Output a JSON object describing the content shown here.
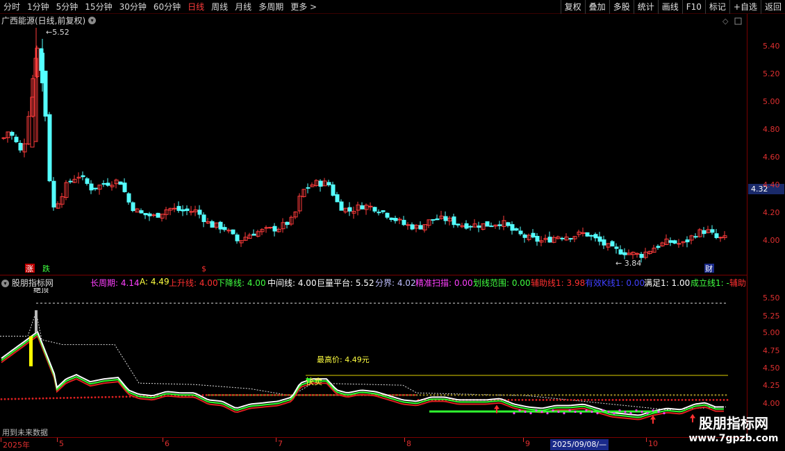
{
  "toolbar": {
    "periods": [
      "分时",
      "1分钟",
      "5分钟",
      "15分钟",
      "30分钟",
      "60分钟",
      "日线",
      "周线",
      "月线",
      "多周期",
      "更多 >"
    ],
    "active_period": "日线",
    "tools": [
      "复权",
      "叠加",
      "多股",
      "统计",
      "画线",
      "F10",
      "标记",
      "+自选",
      "返回"
    ]
  },
  "stock": {
    "title": "广西能源(日线,前复权)",
    "high_mark": "5.52",
    "low_mark": "3.84",
    "current_price": "4.32"
  },
  "price_axis": [
    "5.40",
    "5.20",
    "5.00",
    "4.80",
    "4.60",
    "4.40",
    "4.20",
    "4.00"
  ],
  "markers": {
    "rise": "涨",
    "fall": "跌",
    "dollar": "$",
    "finance": "财"
  },
  "indicator": {
    "name": "股朋指标网",
    "fields": [
      {
        "text": "长周期: 4.14",
        "color": "#ff40ff"
      },
      {
        "text": "A: 4.49",
        "color": "#ffff40"
      },
      {
        "text": "上升线: 4.00",
        "color": "#ff3030"
      },
      {
        "text": "下降线: 4.00",
        "color": "#40ff40"
      },
      {
        "text": "中间线: 4.00",
        "color": "#ffffff"
      },
      {
        "text": "巨量平台: 5.52",
        "color": "#ffffff"
      },
      {
        "text": "分界: 4.02",
        "color": "#c0c0ff"
      },
      {
        "text": "精准扫描: 0.00",
        "color": "#ff40ff"
      },
      {
        "text": "划线范围: 0.00",
        "color": "#40ff40"
      },
      {
        "text": "辅助线1: 3.98",
        "color": "#ff3030"
      },
      {
        "text": "有效K线1: 0.00",
        "color": "#4040ff"
      },
      {
        "text": "满足1: 1.00",
        "color": "#ffffff"
      },
      {
        "text": "成立线1: -",
        "color": "#40ff40"
      },
      {
        "text": "辅助",
        "color": "#ff3030"
      }
    ],
    "axis": [
      "5.50",
      "5.25",
      "5.00",
      "4.75",
      "4.50",
      "4.25",
      "4.00"
    ],
    "annotation_high": "最高价: 4.49元",
    "sell_label": "快卖",
    "top_label": "绝顶",
    "future_note": "用到未来数据"
  },
  "dates": [
    "2025年",
    "5",
    "6",
    "7",
    "8",
    "9",
    "10"
  ],
  "date_cursor": "2025/09/08/—",
  "watermark": {
    "cn": "股朋指标网",
    "url": "www.7gpzb.com"
  },
  "colors": {
    "up": "#ff3c3c",
    "down": "#54ffff",
    "axis": "#e03030",
    "border": "#7a0000"
  }
}
